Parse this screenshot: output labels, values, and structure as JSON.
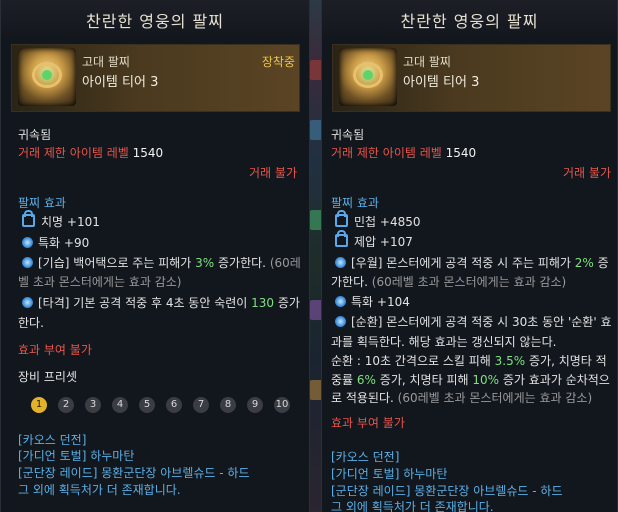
{
  "left": {
    "title": "찬란한 영웅의 팔찌",
    "grade": "고대 팔찌",
    "tier": "아이템 티어 3",
    "equipped": "장착중",
    "bound": "귀속됨",
    "level_req": "거래 제한 아이템 레벨",
    "level_val": "1540",
    "trade": "거래 불가",
    "effect_header": "팔찌 효과",
    "stat1": "치명 +101",
    "stat2": "특화 +90",
    "e1_tag": "[기습]",
    "e1_a": "백어택으로 주는 피해가",
    "e1_pct": "3%",
    "e1_b": "증가한다.",
    "e1_c": "(60레",
    "e1_d": "벨 초과 몬스터에게는 효과 감소)",
    "e2_tag": "[타격]",
    "e2_a": "기본 공격 적중 후 4초 동안 숙련이",
    "e2_val": "130",
    "e2_b": "증가",
    "e2_c": "한다.",
    "no_grant": "효과 부여 불가",
    "preset_label": "장비 프리셋",
    "presets": [
      "1",
      "2",
      "3",
      "4",
      "5",
      "6",
      "7",
      "8",
      "9",
      "10"
    ],
    "src1": "[카오스 던전]",
    "src2": "[가디언 토벌] 하누마탄",
    "src3": "[군단장 레이드] 몽환군단장 아브렐슈드 - 하드",
    "src4": "그 외에 획득처가 더 존재합니다."
  },
  "right": {
    "title": "찬란한 영웅의 팔찌",
    "grade": "고대 팔찌",
    "tier": "아이템 티어 3",
    "bound": "귀속됨",
    "level_req": "거래 제한 아이템 레벨",
    "level_val": "1540",
    "trade": "거래 불가",
    "effect_header": "팔찌 효과",
    "stat1": "민첩 +4850",
    "stat2": "제압 +107",
    "e1_tag": "[우월]",
    "e1_a": "몬스터에게 공격 적중 시 주는 피해가",
    "e1_pct": "2%",
    "e1_b": "증",
    "e1_c": "가한다.",
    "e1_d": "(60레벨 초과 몬스터에게는 효과 감소)",
    "stat3": "특화 +104",
    "e2_tag": "[순환]",
    "e2_a": "몬스터에게 공격 적중 시 30초 동안 '순환' 효",
    "e2_b": "과를 획득한다. 해당 효과는 갱신되지 않는다.",
    "e2_c1": "순환 : 10초 간격으로 스킬 피해",
    "e2_c_pct": "3.5%",
    "e2_c2": "증가, 치명타 적",
    "e2_d1": "중률",
    "e2_d_pct": "6%",
    "e2_d2": "증가, 치명타 피해",
    "e2_d_pct2": "10%",
    "e2_d3": "증가 효과가 순차적으",
    "e2_e1": "로 적용된다.",
    "e2_e2": "(60레벨 초과 몬스터에게는 효과 감소)",
    "no_grant": "효과 부여 불가",
    "src1": "[카오스 던전]",
    "src2": "[가디언 토벌] 하누마탄",
    "src3": "[군단장 레이드] 몽환군단장 아브렐슈드 - 하드",
    "src4": "그 외에 획득처가 더 존재합니다."
  },
  "colors": {
    "red": "#e8554a",
    "blue": "#5ab0e8",
    "green": "#7fe07f",
    "gold": "#e8c64a"
  }
}
